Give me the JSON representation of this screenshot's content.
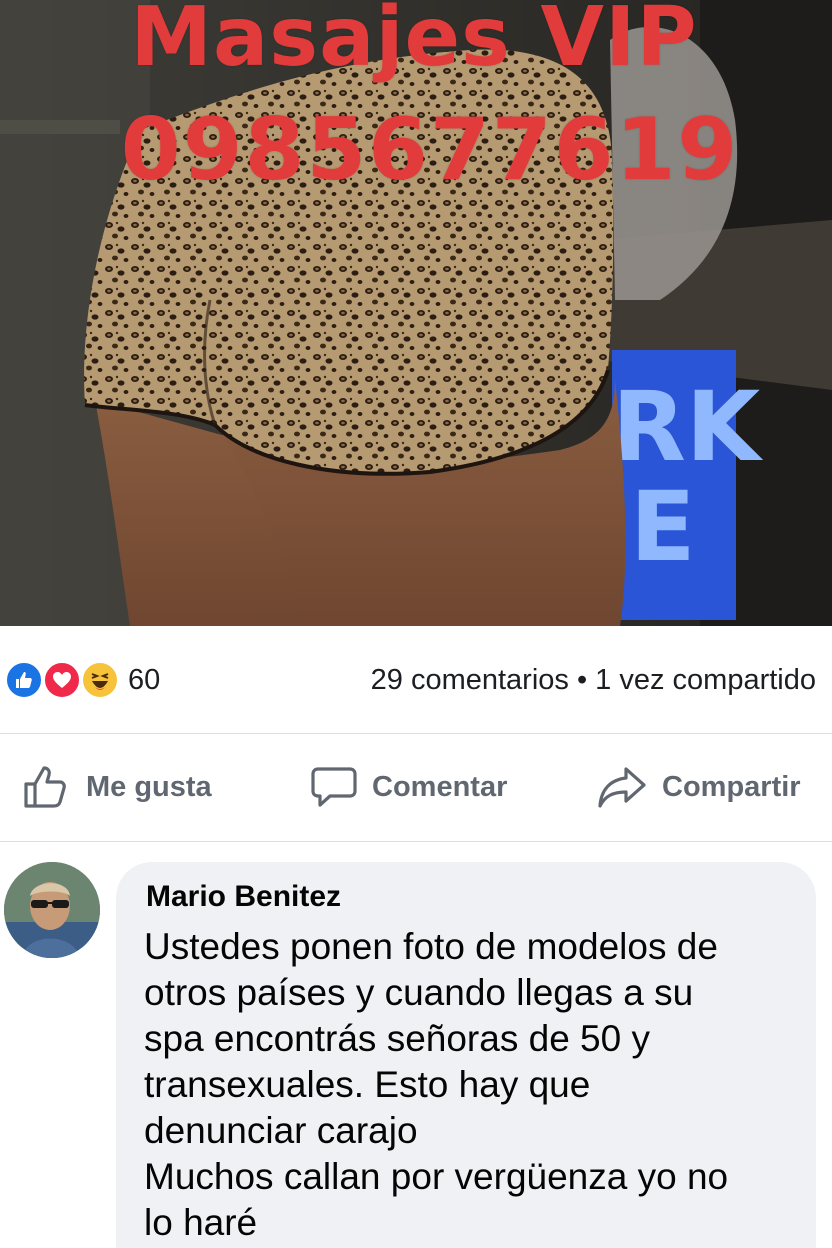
{
  "post": {
    "overlay_title": "Masajes VIP",
    "overlay_phone": "0985677619",
    "neon_sign_text": "RK E"
  },
  "stats": {
    "reaction_count": "60",
    "reactions": [
      "like-icon",
      "love-icon",
      "haha-icon"
    ],
    "comments_shares": "29 comentarios • 1 vez compartido"
  },
  "actions": {
    "like_label": "Me gusta",
    "comment_label": "Comentar",
    "share_label": "Compartir"
  },
  "comment": {
    "author": "Mario Benitez",
    "lines": [
      "Ustedes ponen foto de modelos de",
      "otros países y cuando llegas a su",
      "spa encontrás señoras de 50 y",
      "transexuales.  Esto hay que",
      "denunciar carajo",
      "Muchos callan por vergüenza yo no",
      "lo haré"
    ]
  },
  "colors": {
    "overlay_red": "#e23b3b",
    "like_blue": "#1b74e4",
    "love_red": "#f0284a",
    "haha_yellow": "#f7c33b",
    "action_gray": "#606770",
    "bubble_bg": "#eff1f4"
  }
}
